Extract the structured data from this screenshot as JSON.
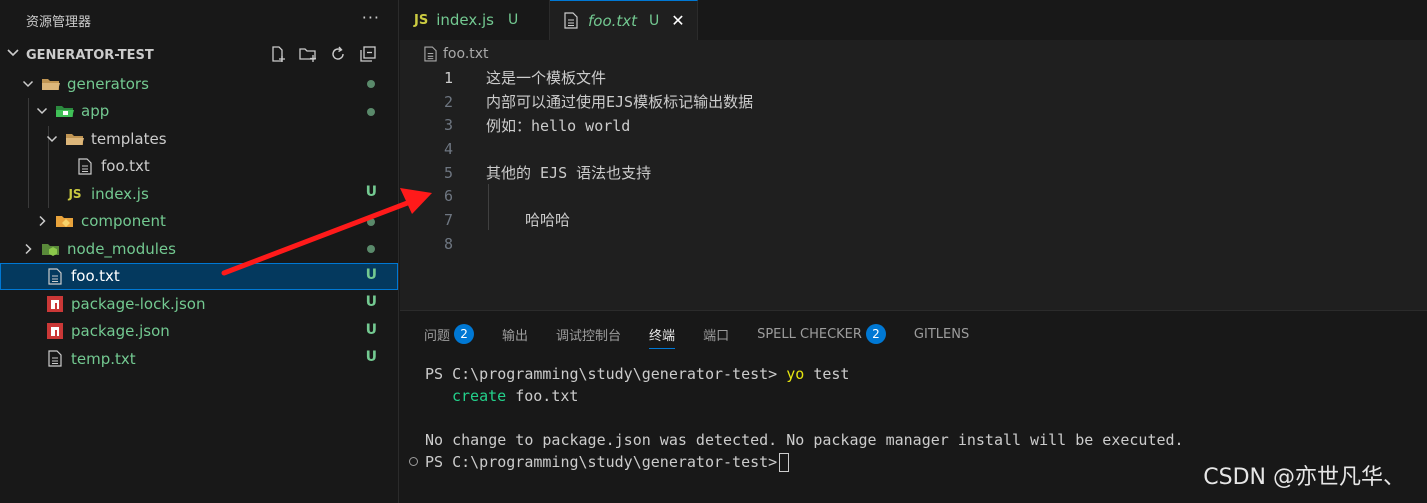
{
  "explorer": {
    "title": "资源管理器",
    "more": "···",
    "root": "GENERATOR-TEST",
    "items": [
      {
        "label": "generators",
        "badge": ""
      },
      {
        "label": "app",
        "badge": ""
      },
      {
        "label": "templates",
        "badge": ""
      },
      {
        "label": "foo.txt",
        "badge": ""
      },
      {
        "label": "index.js",
        "badge": "U",
        "icon_text": "JS"
      },
      {
        "label": "component",
        "badge": ""
      },
      {
        "label": "node_modules",
        "badge": ""
      },
      {
        "label": "foo.txt",
        "badge": "U"
      },
      {
        "label": "package-lock.json",
        "badge": "U"
      },
      {
        "label": "package.json",
        "badge": "U"
      },
      {
        "label": "temp.txt",
        "badge": "U"
      }
    ]
  },
  "tabs": [
    {
      "icon_text": "JS",
      "label": "index.js",
      "status": "U"
    },
    {
      "label": "foo.txt",
      "status": "U",
      "close": "✕"
    }
  ],
  "breadcrumb": "foo.txt",
  "code_lines": [
    {
      "n": "1",
      "text": "这是一个模板文件"
    },
    {
      "n": "2",
      "text": "内部可以通过使用EJS模板标记输出数据"
    },
    {
      "n": "3",
      "text": "例如：hello world"
    },
    {
      "n": "4",
      "text": ""
    },
    {
      "n": "5",
      "text": "其他的 EJS 语法也支持"
    },
    {
      "n": "6",
      "text": ""
    },
    {
      "n": "7",
      "text": "哈哈哈"
    },
    {
      "n": "8",
      "text": ""
    }
  ],
  "panel": {
    "tabs": [
      {
        "label": "问题",
        "badge": "2"
      },
      {
        "label": "输出"
      },
      {
        "label": "调试控制台"
      },
      {
        "label": "终端"
      },
      {
        "label": "端口"
      },
      {
        "label": "SPELL CHECKER",
        "badge": "2"
      },
      {
        "label": "GITLENS"
      }
    ],
    "terminal": {
      "prompt": "PS C:\\programming\\study\\generator-test> ",
      "cmd_yo": "yo",
      "cmd_rest": " test",
      "create_word": "create",
      "create_file": " foo.txt",
      "message": "No change to package.json was detected. No package manager install will be executed.",
      "prompt2": "PS C:\\programming\\study\\generator-test>"
    }
  },
  "watermark": "CSDN @亦世凡华、",
  "colors": {
    "accent": "#0078d4",
    "git_untracked": "#73c991",
    "annotation_arrow": "#ff1a1a"
  }
}
